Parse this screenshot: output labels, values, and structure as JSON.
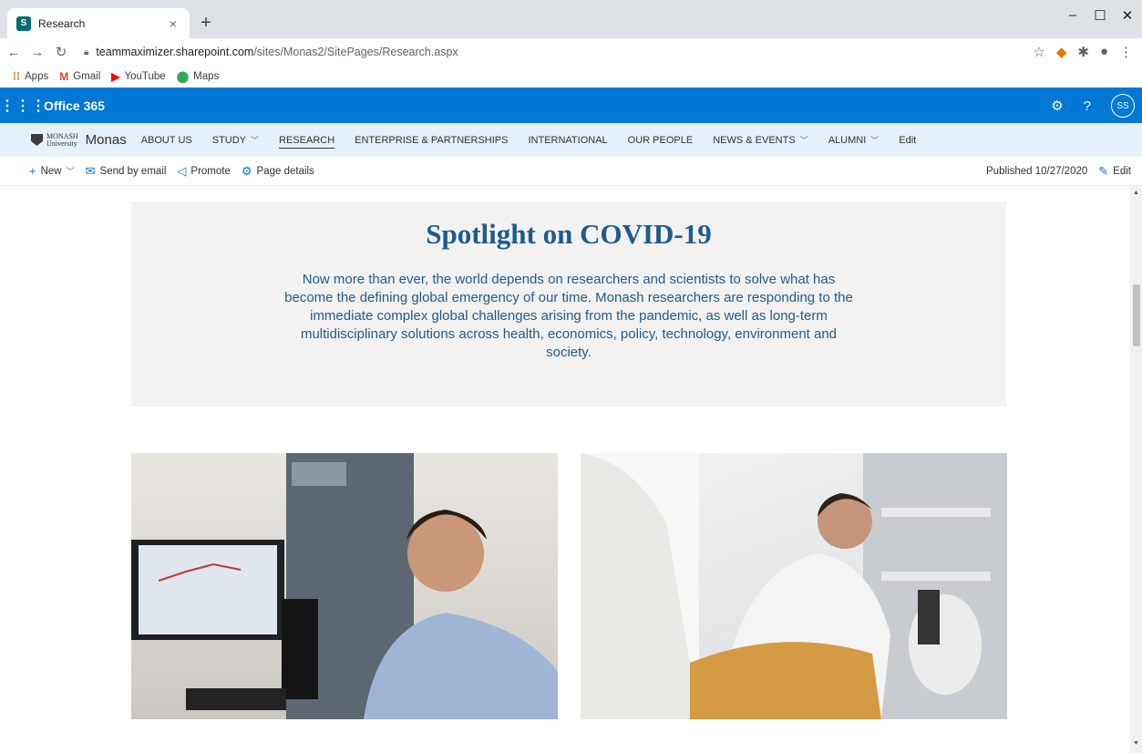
{
  "browser": {
    "tab_title": "Research",
    "tab_close": "×",
    "new_tab": "+",
    "url_host": "teammaximizer.sharepoint.com",
    "url_path": "/sites/Monas2/SitePages/Research.aspx",
    "window_controls": [
      "–",
      "☐",
      "✕"
    ],
    "bookmarks": [
      {
        "label": "Apps",
        "icon": "apps-grid-icon",
        "color": "#e8710a"
      },
      {
        "label": "Gmail",
        "icon": "gmail-icon",
        "color": "#ea4335"
      },
      {
        "label": "YouTube",
        "icon": "youtube-icon",
        "color": "#ff0000"
      },
      {
        "label": "Maps",
        "icon": "maps-pin-icon",
        "color": "#34a853"
      }
    ]
  },
  "suite": {
    "app_name": "Office 365",
    "avatar_initials": "SS",
    "help": "?",
    "brand_color": "#0078d4"
  },
  "site": {
    "logo_line1": "MONASH",
    "logo_line2": "University",
    "name": "Monas",
    "nav": [
      {
        "label": "ABOUT US",
        "chevron": false,
        "active": false
      },
      {
        "label": "STUDY",
        "chevron": true,
        "active": false
      },
      {
        "label": "RESEARCH",
        "chevron": false,
        "active": true
      },
      {
        "label": "ENTERPRISE & PARTNERSHIPS",
        "chevron": false,
        "active": false
      },
      {
        "label": "INTERNATIONAL",
        "chevron": false,
        "active": false
      },
      {
        "label": "OUR PEOPLE",
        "chevron": false,
        "active": false
      },
      {
        "label": "NEWS & EVENTS",
        "chevron": true,
        "active": false
      },
      {
        "label": "ALUMNI",
        "chevron": true,
        "active": false
      }
    ],
    "edit_label": "Edit"
  },
  "commands": {
    "new": "New",
    "send_by_email": "Send by email",
    "promote": "Promote",
    "page_details": "Page details",
    "published": "Published 10/27/2020",
    "edit": "Edit"
  },
  "spotlight": {
    "title": "Spotlight on COVID-19",
    "body": "Now more than ever, the world depends on researchers and scientists to solve what has become the defining global emergency of our time. Monash researchers are responding to the immediate complex global challenges arising from the pandemic, as well as long-term multidisciplinary solutions across health, economics, policy, technology, environment and society."
  }
}
